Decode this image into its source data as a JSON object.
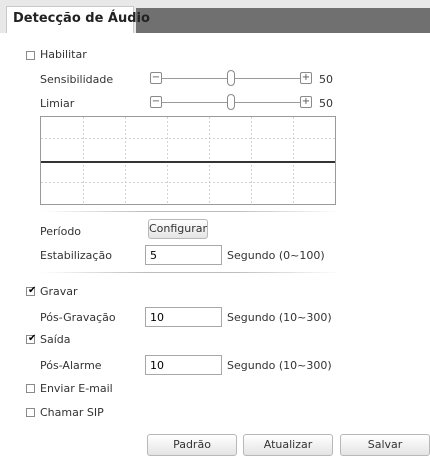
{
  "header": {
    "tab_title": "Detecção de Áudio"
  },
  "enable": {
    "label": "Habilitar",
    "checked": false
  },
  "sensitivity": {
    "label": "Sensibilidade",
    "value": "50",
    "level": 0.5,
    "minus": "−",
    "plus": "+"
  },
  "threshold": {
    "label": "Limiar",
    "value": "50",
    "level": 0.5,
    "minus": "−",
    "plus": "+"
  },
  "period": {
    "label": "Período",
    "button_label": "Configurar"
  },
  "stabilization": {
    "label": "Estabilização",
    "value": "5",
    "unit": "Segundo (0~100)"
  },
  "record": {
    "label": "Gravar",
    "checked": true
  },
  "post_record": {
    "label": "Pós-Gravação",
    "value": "10",
    "unit": "Segundo (10~300)"
  },
  "output": {
    "label": "Saída",
    "checked": true
  },
  "post_alarm": {
    "label": "Pós-Alarme",
    "value": "10",
    "unit": "Segundo (10~300)"
  },
  "send_email": {
    "label": "Enviar E-mail",
    "checked": false
  },
  "call_sip": {
    "label": "Chamar SIP",
    "checked": false
  },
  "footer": {
    "default_label": "Padrão",
    "refresh_label": "Atualizar",
    "save_label": "Salvar"
  },
  "check_mark": "✔",
  "colors": {
    "header_bg": "#707070",
    "threshold_line": "#333333"
  }
}
